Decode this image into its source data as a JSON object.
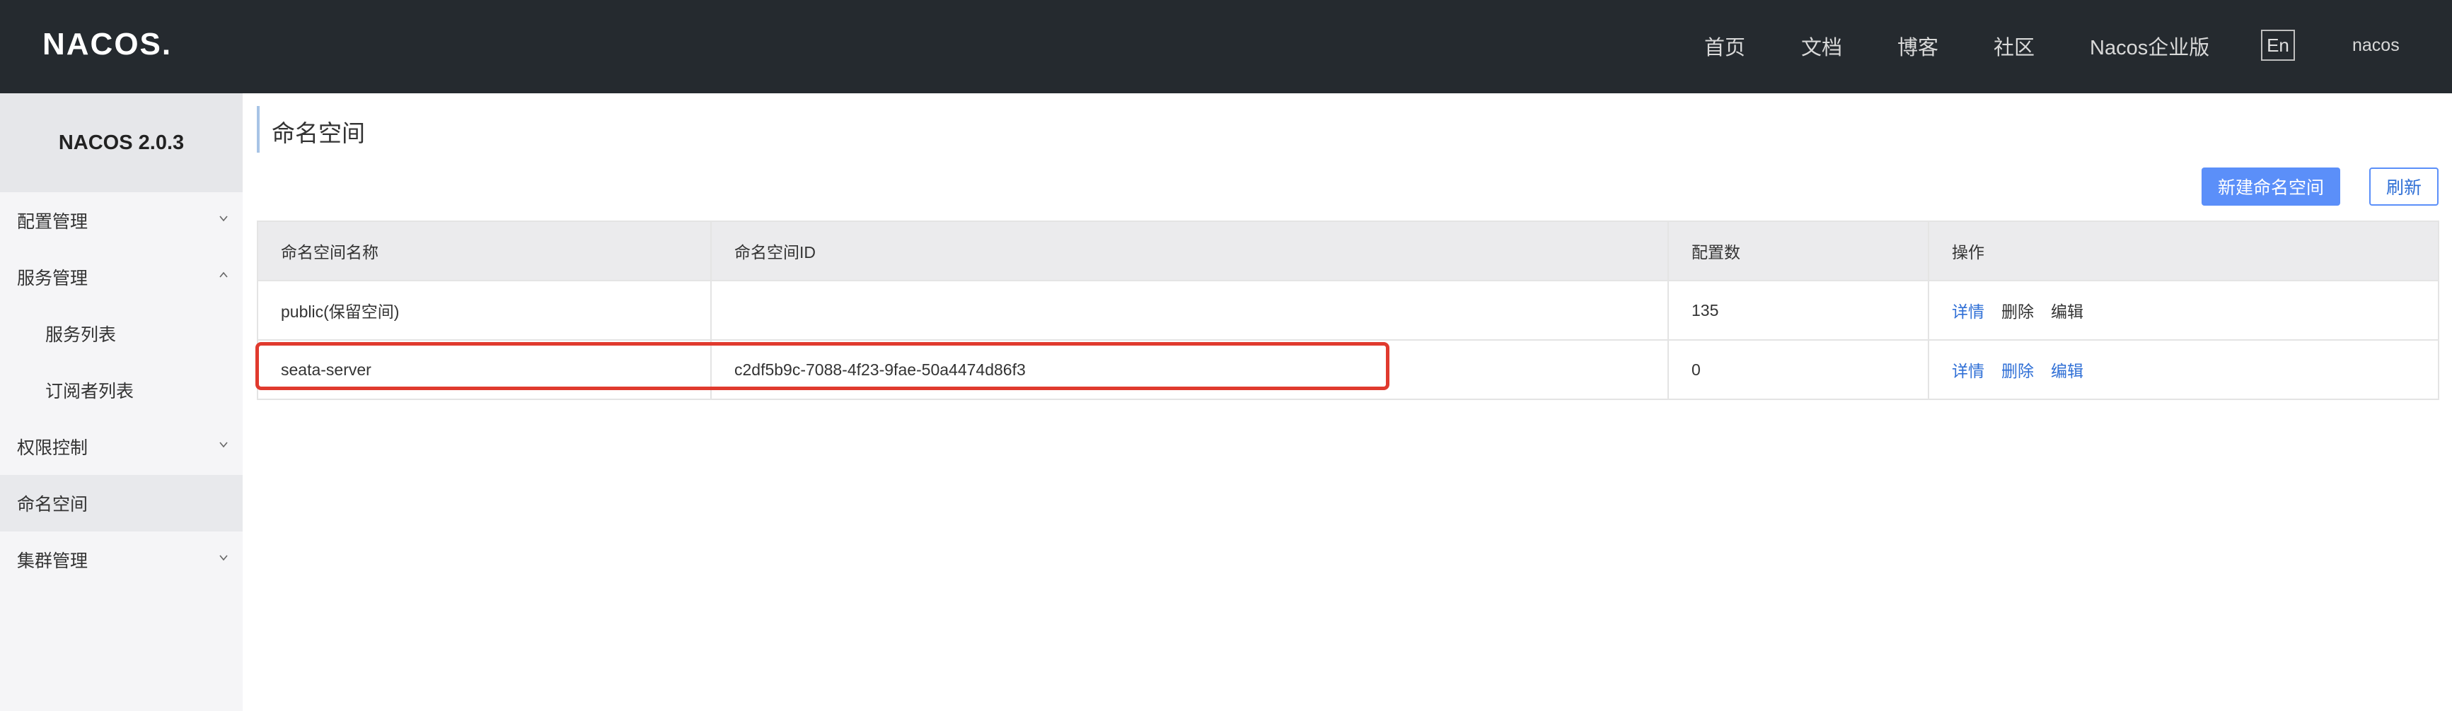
{
  "header": {
    "logo_text": "NACOS.",
    "nav": [
      "首页",
      "文档",
      "博客",
      "社区",
      "Nacos企业版"
    ],
    "lang_button": "En",
    "user": "nacos"
  },
  "sidebar": {
    "version": "NACOS 2.0.3",
    "items": [
      {
        "label": "配置管理",
        "chevron": "down"
      },
      {
        "label": "服务管理",
        "chevron": "up"
      },
      {
        "label": "服务列表",
        "chevron": ""
      },
      {
        "label": "订阅者列表",
        "chevron": ""
      },
      {
        "label": "权限控制",
        "chevron": "down"
      },
      {
        "label": "命名空间",
        "chevron": ""
      },
      {
        "label": "集群管理",
        "chevron": "down"
      }
    ]
  },
  "main": {
    "title": "命名空间",
    "new_button": "新建命名空间",
    "refresh_button": "刷新"
  },
  "table": {
    "columns": [
      "命名空间名称",
      "命名空间ID",
      "配置数",
      "操作"
    ],
    "rows": [
      {
        "name": "public(保留空间)",
        "id": "",
        "count": "135",
        "actions": [
          "详情",
          "删除",
          "编辑"
        ]
      },
      {
        "name": "seata-server",
        "id": "c2df5b9c-7088-4f23-9fae-50a4474d86f3",
        "count": "0",
        "actions": [
          "详情",
          "删除",
          "编辑"
        ]
      }
    ]
  },
  "colors": {
    "header_bg": "#252a2f",
    "primary": "#5b8ff9",
    "link": "#2f6fd6",
    "highlight": "#e03a2e"
  }
}
